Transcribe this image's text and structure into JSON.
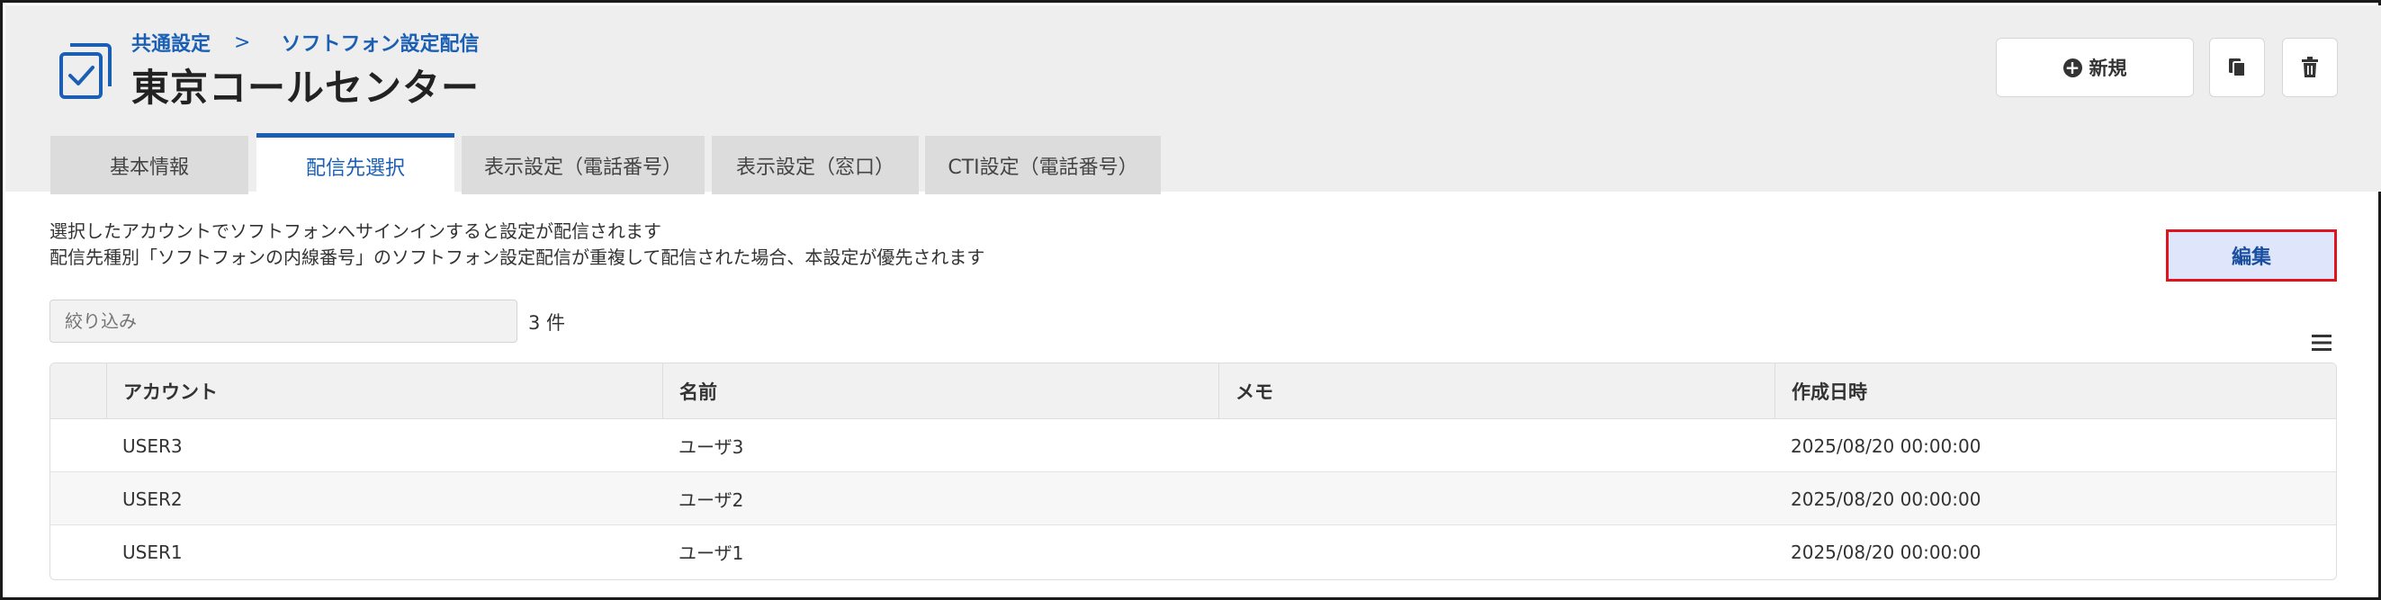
{
  "breadcrumb": {
    "parent": "共通設定",
    "separator": ">",
    "current": "ソフトフォン設定配信"
  },
  "page_title": "東京コールセンター",
  "toolbar": {
    "new_label": "新規",
    "icons": [
      "plus-circle-icon",
      "copy-icon",
      "trash-icon"
    ]
  },
  "tabs": [
    {
      "label": "基本情報",
      "active": false
    },
    {
      "label": "配信先選択",
      "active": true
    },
    {
      "label": "表示設定（電話番号）",
      "active": false
    },
    {
      "label": "表示設定（窓口）",
      "active": false
    },
    {
      "label": "CTI設定（電話番号）",
      "active": false
    }
  ],
  "description": {
    "line1": "選択したアカウントでソフトフォンへサインインすると設定が配信されます",
    "line2": "配信先種別「ソフトフォンの内線番号」のソフトフォン設定配信が重複して配信された場合、本設定が優先されます"
  },
  "edit_button": "編集",
  "filter": {
    "placeholder": "絞り込み",
    "count": "3 件"
  },
  "table": {
    "columns": [
      "アカウント",
      "名前",
      "メモ",
      "作成日時"
    ],
    "rows": [
      {
        "account": "USER3",
        "name": "ユーザ3",
        "memo": "",
        "created": "2025/08/20 00:00:00"
      },
      {
        "account": "USER2",
        "name": "ユーザ2",
        "memo": "",
        "created": "2025/08/20 00:00:00"
      },
      {
        "account": "USER1",
        "name": "ユーザ1",
        "memo": "",
        "created": "2025/08/20 00:00:00"
      }
    ]
  },
  "colors": {
    "accent": "#1a5fb4",
    "edit_bg": "#dfe6fb",
    "edit_border": "#e0141e",
    "header_bg": "#eeeeee"
  }
}
